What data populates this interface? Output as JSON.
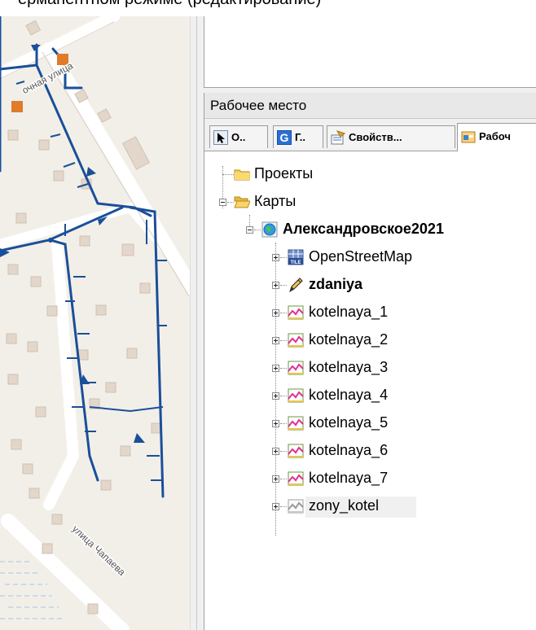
{
  "top_caption": "ерманентном режиме (редактирование)",
  "workspace": {
    "title": "Рабочее место",
    "tabs": [
      {
        "label": "О..",
        "icon": "select-arrow-icon"
      },
      {
        "label": "Г..",
        "icon": "google-g-icon"
      },
      {
        "label": "Свойств...",
        "icon": "properties-icon"
      },
      {
        "label": "Рабоч",
        "icon": "workspace-icon"
      }
    ]
  },
  "tree": {
    "projects": "Проекты",
    "maps": "Карты",
    "map_name": "Александровское2021",
    "layers": [
      {
        "label": "OpenStreetMap",
        "icon": "tile-layer-icon"
      },
      {
        "label": "zdaniya",
        "icon": "edit-pencil-icon",
        "bold": true
      },
      {
        "label": "kotelnaya_1",
        "icon": "vector-layer-icon"
      },
      {
        "label": "kotelnaya_2",
        "icon": "vector-layer-icon"
      },
      {
        "label": "kotelnaya_3",
        "icon": "vector-layer-icon"
      },
      {
        "label": "kotelnaya_4",
        "icon": "vector-layer-icon"
      },
      {
        "label": "kotelnaya_5",
        "icon": "vector-layer-icon"
      },
      {
        "label": "kotelnaya_6",
        "icon": "vector-layer-icon"
      },
      {
        "label": "kotelnaya_7",
        "icon": "vector-layer-icon"
      },
      {
        "label": "zony_kotel",
        "icon": "vector-layer-disabled-icon",
        "selected": true
      }
    ]
  },
  "map": {
    "street_1": "очная улица",
    "street_2": "улица Чапаева",
    "colors": {
      "network": "#1a4f99",
      "road": "#ffffff",
      "background": "#f2efe9",
      "building": "#e3d7cb",
      "poi": "#e07b2a"
    }
  }
}
